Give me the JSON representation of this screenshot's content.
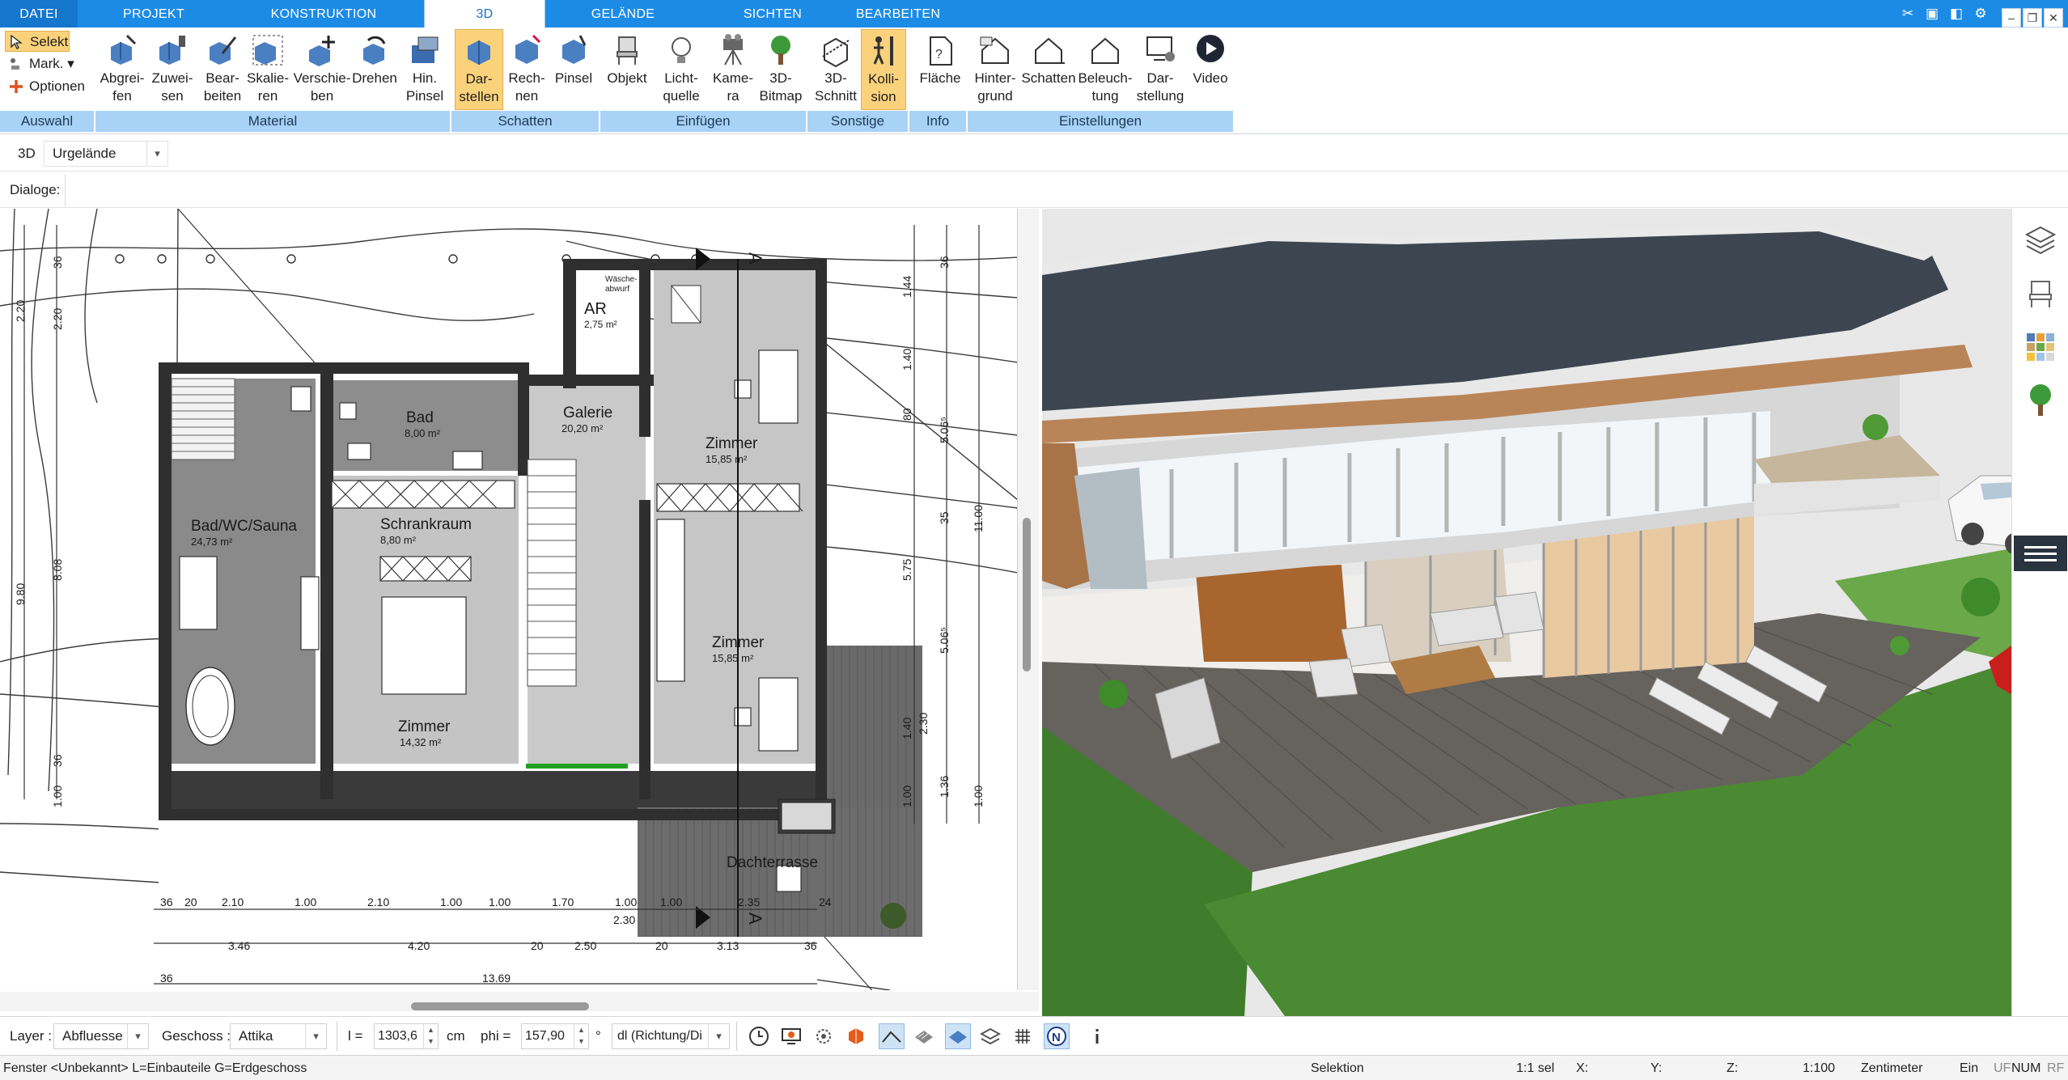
{
  "menu": {
    "tabs": [
      "DATEI",
      "PROJEKT",
      "KONSTRUKTION",
      "3D",
      "GELÄNDE",
      "SICHTEN",
      "BEARBEITEN"
    ],
    "active_tab": "3D"
  },
  "ribbon": {
    "auswahl": {
      "selekt": "Selekt",
      "mark": "Mark.",
      "optionen": "Optionen",
      "group": "Auswahl"
    },
    "material": {
      "group": "Material",
      "buttons": [
        "Abgrei-\nfen",
        "Zuwei-\nsen",
        "Bear-\nbeiten",
        "Skalie-\nren",
        "Verschie-\nben",
        "Drehen",
        "Hin.\nPinsel"
      ]
    },
    "schatten": {
      "group": "Schatten",
      "buttons": [
        "Dar-\nstellen",
        "Rech-\nnen",
        "Pinsel"
      ]
    },
    "einfuegen": {
      "group": "Einfügen",
      "buttons": [
        "Objekt",
        "Licht-\nquelle",
        "Kame-\nra",
        "3D-\nBitmap"
      ]
    },
    "sonstige": {
      "group": "Sonstige",
      "buttons": [
        "3D-\nSchnitt",
        "Kolli-\nsion"
      ]
    },
    "info": {
      "group": "Info",
      "buttons": [
        "Fläche"
      ]
    },
    "einstellungen": {
      "group": "Einstellungen",
      "buttons": [
        "Hinter-\ngrund",
        "Schatten",
        "Beleuch-\ntung",
        "Dar-\nstellung",
        "Video"
      ]
    }
  },
  "subbar": {
    "mode": "3D",
    "terrain": "Urgelände",
    "dialoge": "Dialoge:"
  },
  "plan": {
    "rooms": [
      {
        "name": "AR",
        "area": "2,75 m²"
      },
      {
        "name": "Wäsche-",
        "area": "abwurf"
      },
      {
        "name": "Bad",
        "area": "8,00 m²"
      },
      {
        "name": "Galerie",
        "area": "20,20 m²"
      },
      {
        "name": "Zimmer",
        "area": "15,85 m²"
      },
      {
        "name": "Bad/WC/Sauna",
        "area": "24,73 m²"
      },
      {
        "name": "Schrankraum",
        "area": "8,80 m²"
      },
      {
        "name": "Zimmer",
        "area": "15,85 m²"
      },
      {
        "name": "Zimmer",
        "area": "14,32 m²"
      },
      {
        "name": "Dachterrasse",
        "area": ""
      }
    ],
    "section_marker": "A",
    "dims_bottom_row1": [
      "36",
      "20",
      "2.10",
      "1.00",
      "2.10",
      "1.00",
      "1.00",
      "1.70",
      "1.00",
      "1.00",
      "2.35",
      "24"
    ],
    "dims_bottom_extra": "2.30",
    "dims_bottom_row2": [
      "3.46",
      "4.20",
      "20",
      "2.50",
      "20",
      "3.13",
      "36"
    ],
    "dims_bottom_row3": [
      "36",
      "13.69"
    ],
    "dims_left": [
      "2.20",
      "36",
      "2.20",
      "9.80",
      "8.08",
      "36",
      "1.00"
    ],
    "dims_right": [
      "1.44",
      "36",
      "1.40",
      "80",
      "5.06⁵",
      "35",
      "11.00",
      "5.75",
      "5.06⁵",
      "1.40",
      "2.30",
      "1.00",
      "1.36",
      "1.00"
    ]
  },
  "bottombar": {
    "layer_label": "Layer :",
    "layer_value": "Abfluesse",
    "geschoss_label": "Geschoss :",
    "geschoss_value": "Attika",
    "l_label": "l =",
    "l_value": "1303,6",
    "l_unit": "cm",
    "phi_label": "phi =",
    "phi_value": "157,90",
    "phi_unit": "°",
    "dl_value": "dl (Richtung/Di"
  },
  "status": {
    "left": "Fenster <Unbekannt> L=Einbauteile G=Erdgeschoss",
    "selektion": "Selektion",
    "sel": "1:1 sel",
    "x": "X:",
    "y": "Y:",
    "z": "Z:",
    "scale": "1:100",
    "unit": "Zentimeter",
    "ein": "Ein",
    "uf": "UF",
    "num": "NUM",
    "rf": "RF"
  }
}
